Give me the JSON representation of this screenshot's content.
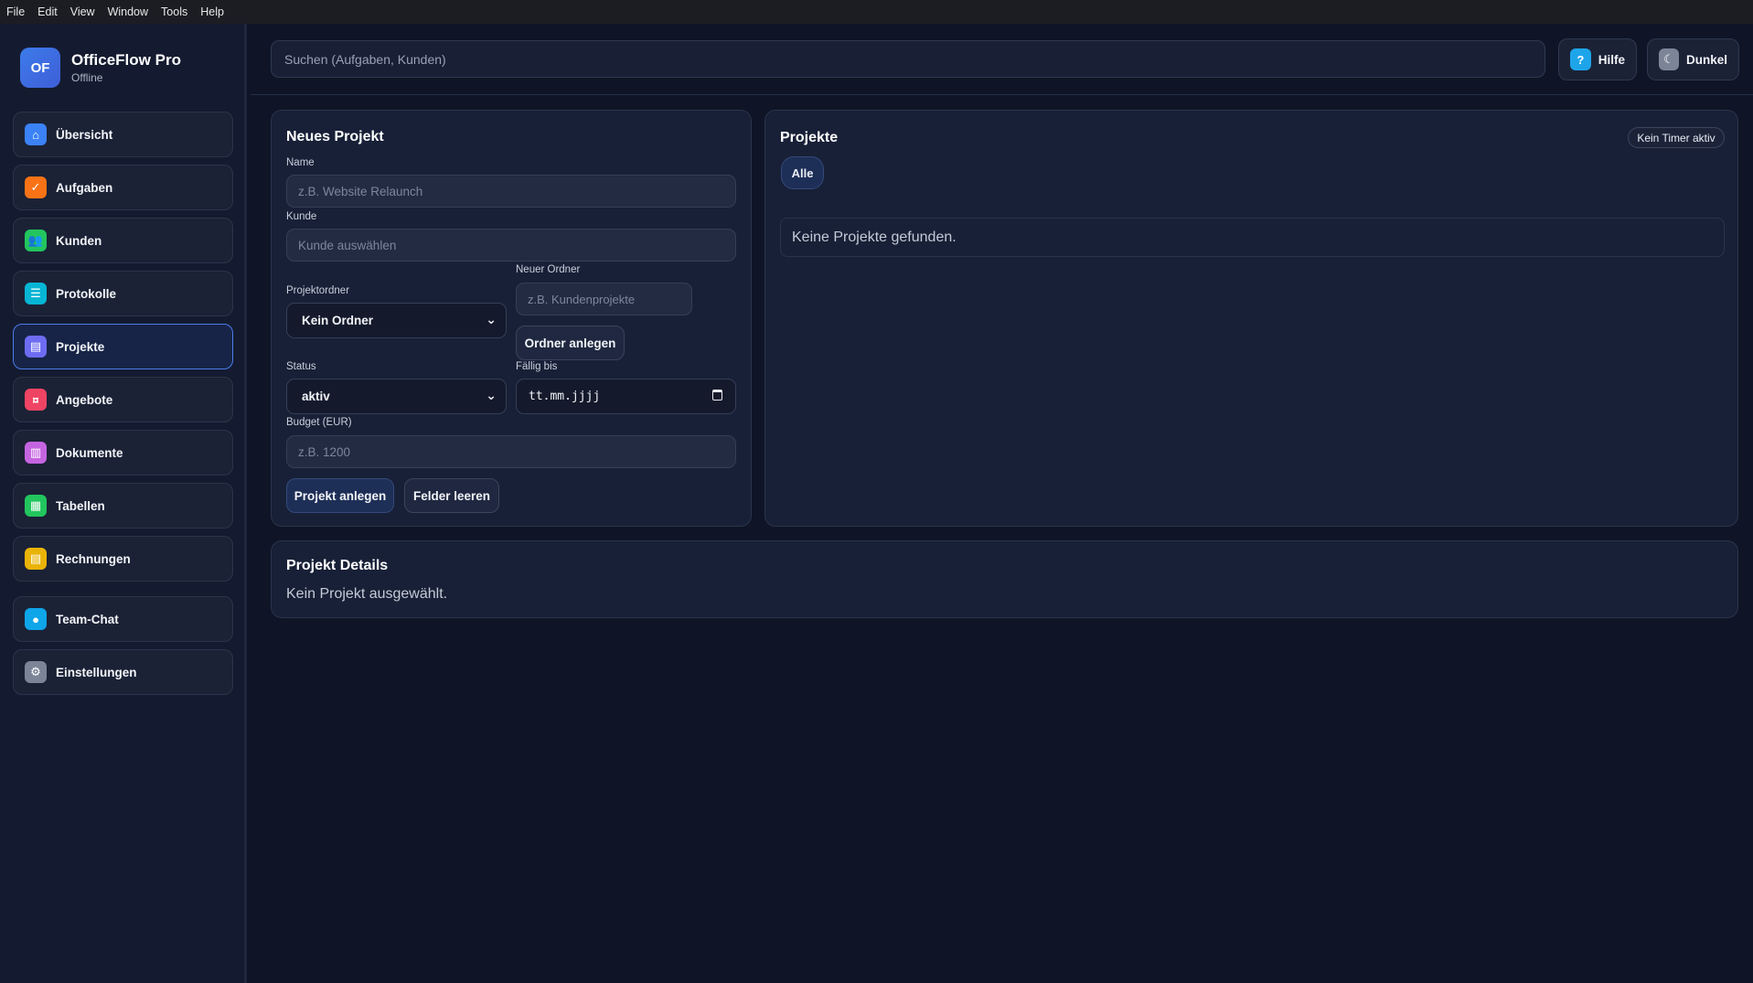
{
  "menubar": {
    "items": [
      "File",
      "Edit",
      "View",
      "Window",
      "Tools",
      "Help"
    ]
  },
  "brand": {
    "logo": "OF",
    "name": "OfficeFlow Pro",
    "status": "Offline"
  },
  "nav": {
    "items": [
      {
        "label": "Übersicht",
        "icon": "home-icon",
        "color": "#3b82f6",
        "glyph": "⌂"
      },
      {
        "label": "Aufgaben",
        "icon": "check-icon",
        "color": "#f97316",
        "glyph": "✓"
      },
      {
        "label": "Kunden",
        "icon": "users-icon",
        "color": "#22c55e",
        "glyph": "👥"
      },
      {
        "label": "Protokolle",
        "icon": "list-icon",
        "color": "#06b6d4",
        "glyph": "☰"
      },
      {
        "label": "Projekte",
        "icon": "folder-icon",
        "color": "#6d6cf2",
        "glyph": "▤"
      },
      {
        "label": "Angebote",
        "icon": "tag-icon",
        "color": "#ef4463",
        "glyph": "¤"
      },
      {
        "label": "Dokumente",
        "icon": "document-icon",
        "color": "#c564e0",
        "glyph": "▥"
      },
      {
        "label": "Tabellen",
        "icon": "table-icon",
        "color": "#22c55e",
        "glyph": "▦"
      },
      {
        "label": "Rechnungen",
        "icon": "invoice-icon",
        "color": "#eab308",
        "glyph": "▤"
      },
      {
        "label": "Team-Chat",
        "icon": "chat-icon",
        "color": "#0ea5e9",
        "glyph": "●"
      },
      {
        "label": "Einstellungen",
        "icon": "gear-icon",
        "color": "#7c8597",
        "glyph": "⚙"
      }
    ],
    "active_index": 4
  },
  "topbar": {
    "search_placeholder": "Suchen (Aufgaben, Kunden)",
    "help_label": "Hilfe",
    "help_glyph": "?",
    "help_color": "#1ea5e9",
    "theme_label": "Dunkel",
    "theme_glyph": "☾",
    "theme_color": "#7c8597"
  },
  "new_project": {
    "title": "Neues Projekt",
    "name_label": "Name",
    "name_placeholder": "z.B. Website Relaunch",
    "customer_label": "Kunde",
    "customer_placeholder": "Kunde auswählen",
    "folder_label": "Projektordner",
    "folder_value": "Kein Ordner",
    "new_folder_label": "Neuer Ordner",
    "new_folder_placeholder": "z.B. Kundenprojekte",
    "create_folder_button": "Ordner anlegen",
    "status_label": "Status",
    "status_value": "aktiv",
    "due_label": "Fällig bis",
    "due_placeholder": "tt.mm.jjjj",
    "budget_label": "Budget (EUR)",
    "budget_placeholder": "z.B. 1200",
    "create_button": "Projekt anlegen",
    "clear_button": "Felder leeren"
  },
  "projects": {
    "title": "Projekte",
    "timer_badge": "Kein Timer aktiv",
    "filter_all": "Alle",
    "empty_text": "Keine Projekte gefunden."
  },
  "details": {
    "title": "Projekt Details",
    "empty_text": "Kein Projekt ausgewählt."
  }
}
